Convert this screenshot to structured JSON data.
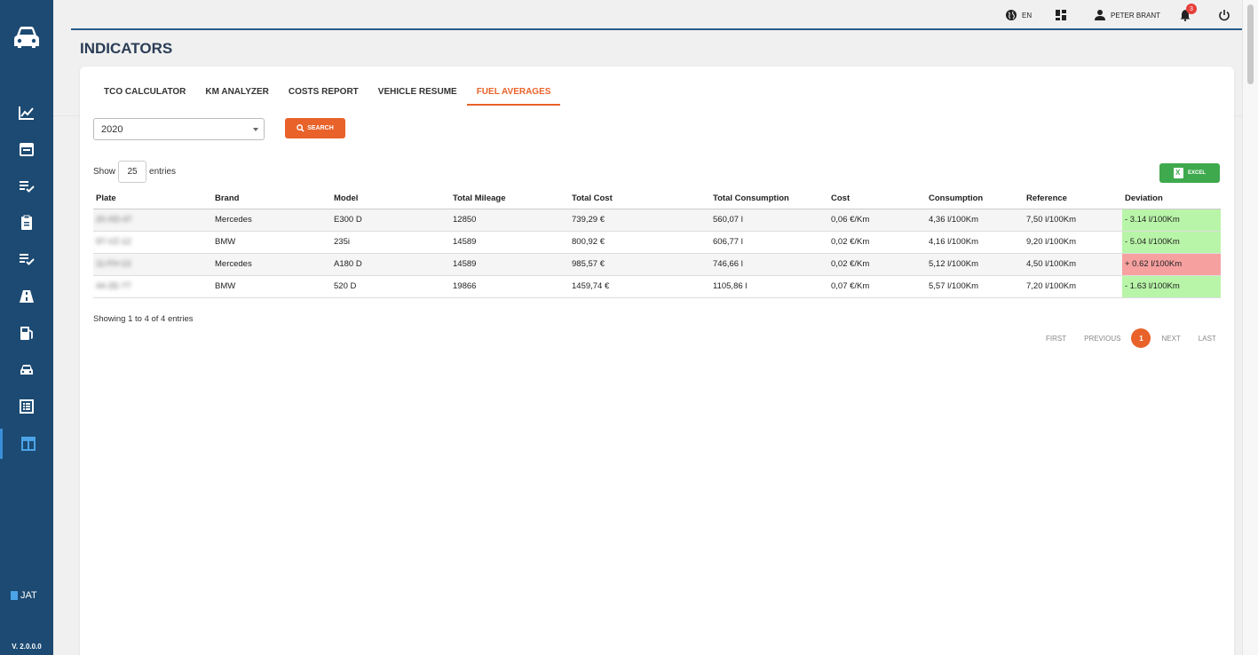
{
  "user": {
    "language": "EN",
    "name": "PETER BRANT",
    "notifications": "3"
  },
  "page": {
    "title": "INDICATORS"
  },
  "tabs": [
    {
      "label": "TCO CALCULATOR"
    },
    {
      "label": "KM ANALYZER"
    },
    {
      "label": "COSTS REPORT"
    },
    {
      "label": "VEHICLE RESUME"
    },
    {
      "label": "FUEL AVERAGES",
      "active": true
    }
  ],
  "filters": {
    "year": "2020",
    "search_label": "SEARCH"
  },
  "length": {
    "show_label": "Show",
    "value": "25",
    "entries_label": "entries"
  },
  "excel_label": "EXCEL",
  "table": {
    "headers": [
      "Plate",
      "Brand",
      "Model",
      "Total Mileage",
      "Total Cost",
      "Total Consumption",
      "Cost",
      "Consumption",
      "Reference",
      "Deviation"
    ],
    "rows": [
      [
        "20-XD-47",
        "Mercedes",
        "E300 D",
        "12850",
        "739,29 €",
        "560,07 l",
        "0,06 €/Km",
        "4,36 l/100Km",
        "7,50 l/100Km",
        "- 3.14 l/100Km"
      ],
      [
        "97-VZ-12",
        "BMW",
        "235i",
        "14589",
        "800,92 €",
        "606,77 l",
        "0,02 €/Km",
        "4,16 l/100Km",
        "9,20 l/100Km",
        "- 5.04 l/100Km"
      ],
      [
        "11-FH-13",
        "Mercedes",
        "A180 D",
        "14589",
        "985,57 €",
        "746,66 l",
        "0,02 €/Km",
        "5,12 l/100Km",
        "4,50 l/100Km",
        "+ 0.62 l/100Km"
      ],
      [
        "44-ZE-77",
        "BMW",
        "520 D",
        "19866",
        "1459,74 €",
        "1105,86 l",
        "0,07 €/Km",
        "5,57 l/100Km",
        "7,20 l/100Km",
        "- 1.63 l/100Km"
      ]
    ],
    "deviation_status": [
      "good",
      "good",
      "bad",
      "good"
    ]
  },
  "info_text": "Showing 1 to 4 of 4 entries",
  "pagination": {
    "first": "FIRST",
    "previous": "PREVIOUS",
    "current": "1",
    "next": "NEXT",
    "last": "LAST"
  },
  "sidebar": {
    "brand": "JAT",
    "version": "V. 2.0.0.0",
    "items": [
      {
        "icon": "chart-line-icon"
      },
      {
        "icon": "calendar-icon"
      },
      {
        "icon": "list-check-icon"
      },
      {
        "icon": "clipboard-icon"
      },
      {
        "icon": "list-check-icon"
      },
      {
        "icon": "road-icon"
      },
      {
        "icon": "fuel-pump-icon"
      },
      {
        "icon": "car-icon"
      },
      {
        "icon": "table-list-icon"
      },
      {
        "icon": "table-icon",
        "active": true
      }
    ]
  },
  "colors": {
    "sidebar": "#1c4a72",
    "accent": "#e8622a",
    "excel": "#3fa94d",
    "deviation_good": "#b8f5a8",
    "deviation_bad": "#f7a0a0"
  }
}
